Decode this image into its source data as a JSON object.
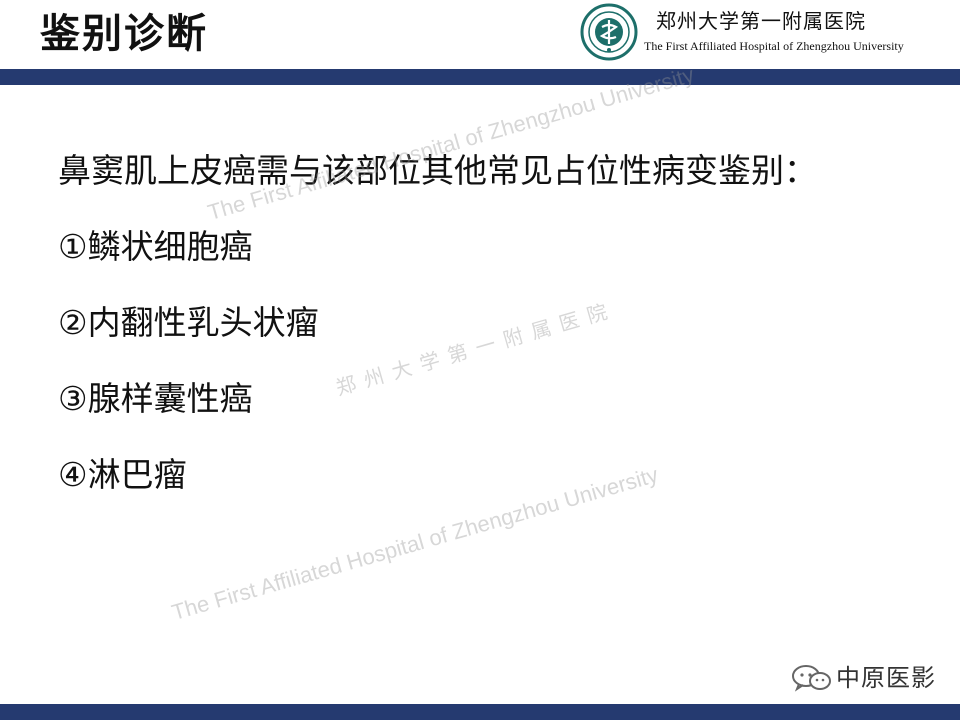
{
  "slide": {
    "title": "鉴别诊断",
    "hospital_name_cn": "郑州大学第一附属医院",
    "hospital_name_en": "The First Affiliated Hospital of Zhengzhou University",
    "intro": "鼻窦肌上皮癌需与该部位其他常见占位性病变鉴别：",
    "items": [
      "①鳞状细胞癌",
      "②内翻性乳头状瘤",
      "③腺样囊性癌",
      "④淋巴瘤"
    ]
  },
  "watermark": {
    "text_en": "The First Affiliated Hospital of Zhengzhou University",
    "text_cn": "郑州大学第一附属医院"
  },
  "footer": {
    "brand": "中原医影"
  },
  "colors": {
    "bar": "#253a70",
    "logo": "#1d6f6a"
  },
  "icons": {
    "logo": "hospital-logo",
    "wechat": "wechat-icon"
  }
}
